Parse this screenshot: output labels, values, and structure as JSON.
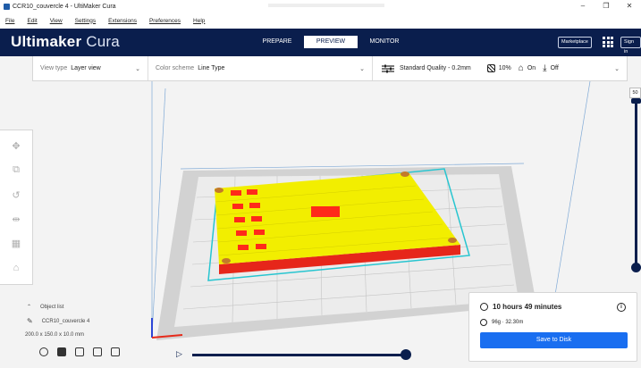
{
  "window": {
    "title": "CCR10_couvercle 4 - UltiMaker Cura",
    "controls": [
      "–",
      "❐",
      "✕"
    ]
  },
  "menu": [
    "File",
    "Edit",
    "View",
    "Settings",
    "Extensions",
    "Preferences",
    "Help"
  ],
  "header": {
    "brand_bold": "Ultimaker",
    "brand_light": "Cura",
    "tabs": [
      "PREPARE",
      "PREVIEW",
      "MONITOR"
    ],
    "active_tab": "PREVIEW",
    "marketplace_label": "Marketplace",
    "signin_label": "Sign in"
  },
  "toolbar": {
    "view_type_label": "View type",
    "view_type_value": "Layer view",
    "color_scheme_label": "Color scheme",
    "color_scheme_value": "Line Type",
    "quality": "Standard Quality - 0.2mm",
    "infill": "10%",
    "support": "On",
    "adhesion": "Off"
  },
  "layer_slider": {
    "max_layer": "50"
  },
  "object_list": {
    "header": "Object list",
    "object_name": "CCR10_couvercle 4",
    "dimensions": "200.0 x 150.0 x 10.0 mm"
  },
  "summary": {
    "print_time": "10 hours 49 minutes",
    "material": "96g · 32.30m",
    "save_label": "Save to Disk"
  },
  "colors": {
    "header_bg": "#0a1e4d",
    "accent": "#196ef0",
    "infill_yellow": "#ffff00",
    "wall_red": "#ff2a1a",
    "skirt_cyan": "#27c5d0"
  }
}
